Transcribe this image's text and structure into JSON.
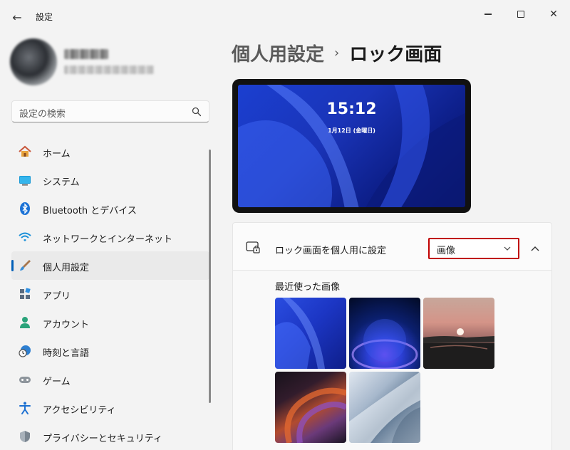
{
  "window": {
    "title": "設定",
    "back_glyph": "←",
    "close_glyph": "✕"
  },
  "search": {
    "placeholder": "設定の検索"
  },
  "sidebar": {
    "items": [
      {
        "label": "ホーム",
        "icon": "home-icon"
      },
      {
        "label": "システム",
        "icon": "system-icon"
      },
      {
        "label": "Bluetooth とデバイス",
        "icon": "bluetooth-icon"
      },
      {
        "label": "ネットワークとインターネット",
        "icon": "wifi-icon"
      },
      {
        "label": "個人用設定",
        "icon": "brush-icon",
        "active": true
      },
      {
        "label": "アプリ",
        "icon": "apps-icon"
      },
      {
        "label": "アカウント",
        "icon": "account-icon"
      },
      {
        "label": "時刻と言語",
        "icon": "clock-globe-icon"
      },
      {
        "label": "ゲーム",
        "icon": "gamepad-icon"
      },
      {
        "label": "アクセシビリティ",
        "icon": "accessibility-icon"
      },
      {
        "label": "プライバシーとセキュリティ",
        "icon": "shield-icon"
      }
    ]
  },
  "breadcrumb": {
    "parent": "個人用設定",
    "separator": "›",
    "current": "ロック画面"
  },
  "preview": {
    "time": "15:12",
    "date": "1月12日 (金曜日)"
  },
  "lock_screen_setting": {
    "label": "ロック画面を個人用に設定",
    "selected": "画像",
    "recent_images_label": "最近使った画像"
  },
  "colors": {
    "accent": "#005fb8",
    "highlight_border": "#c00000"
  }
}
